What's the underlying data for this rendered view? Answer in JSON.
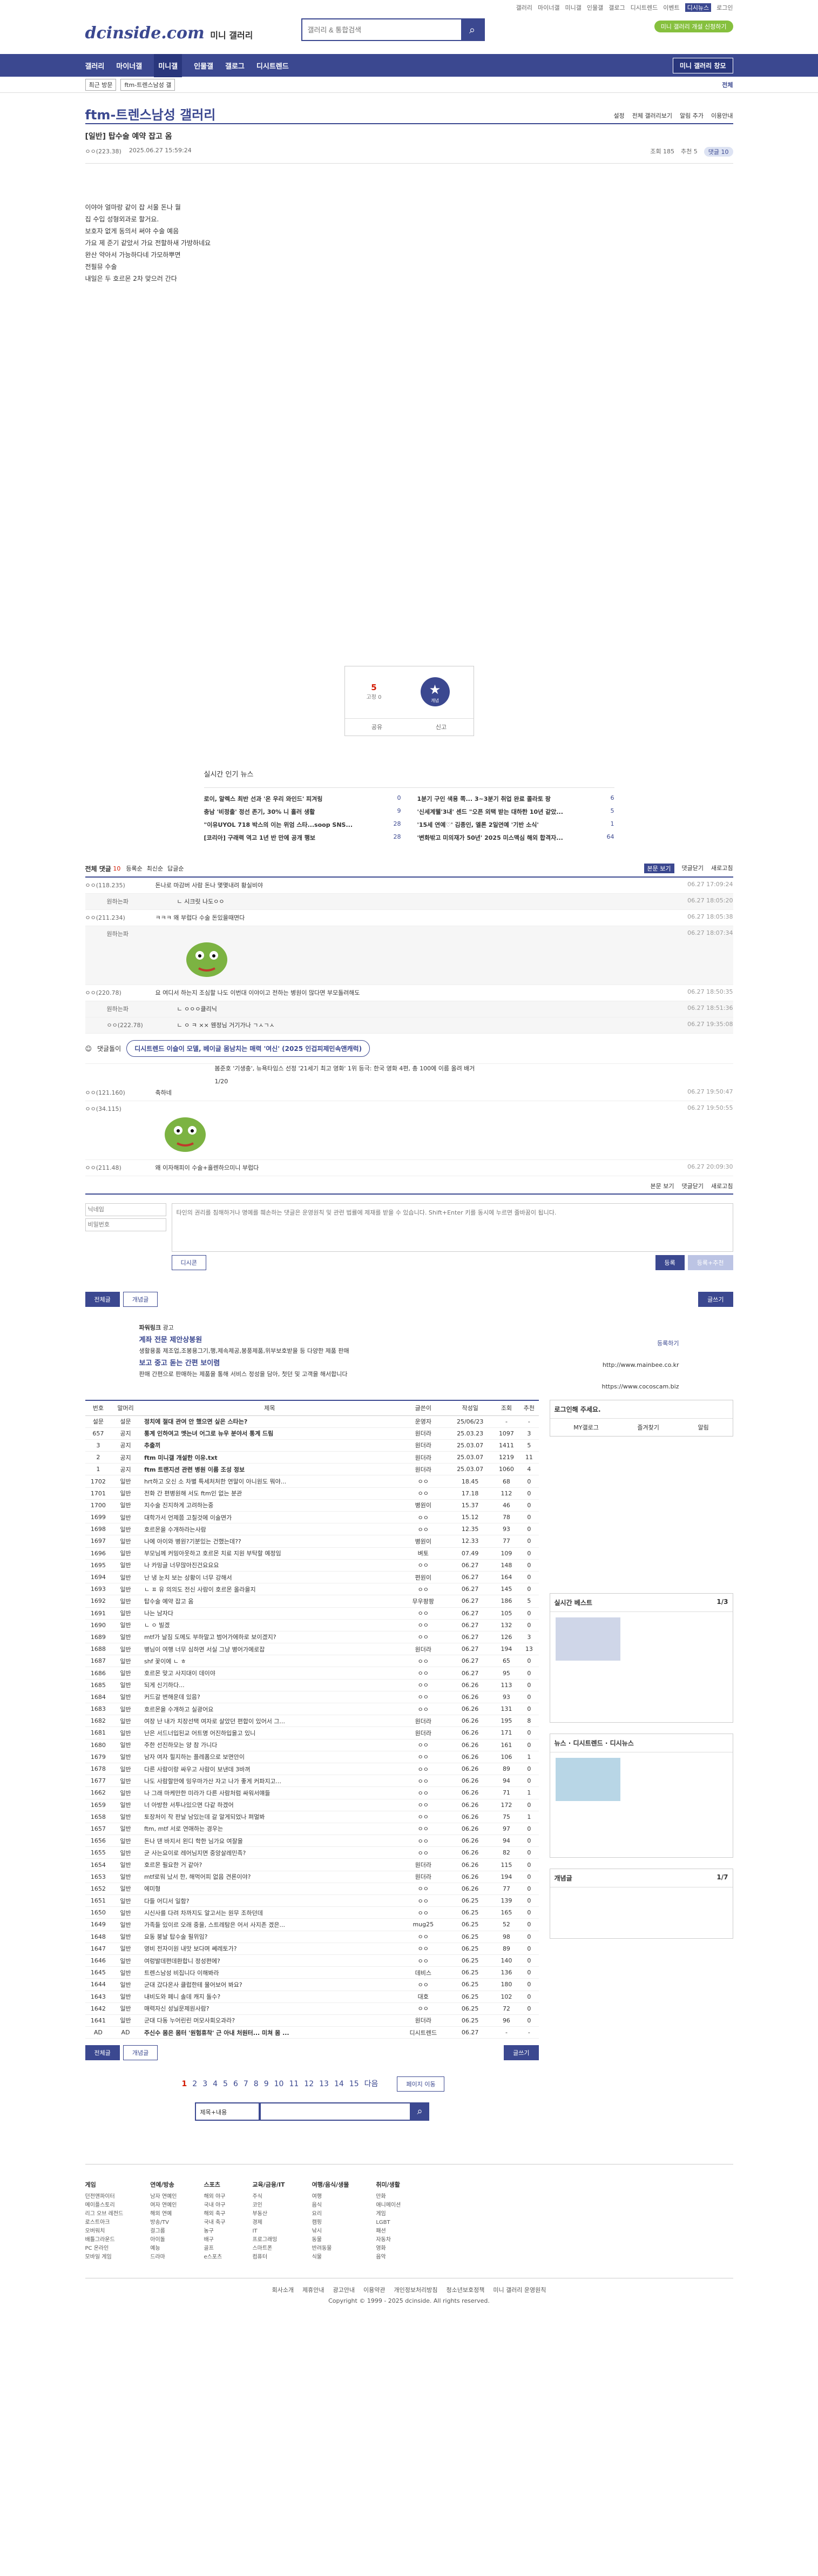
{
  "util": [
    "갤러리",
    "마이너갤",
    "미니갤",
    "인물갤",
    "갤로그",
    "디시트렌드",
    "이벤트",
    "디시뉴스",
    "로그인"
  ],
  "header": {
    "logo": "dcinside.com",
    "logo_sub": "미니 갤러리",
    "search_placeholder": "갤러리 & 통합검색",
    "green_btn": "미니 갤러리 개설 신청하기"
  },
  "gnb": {
    "items": [
      "갤러리",
      "마이너갤",
      "미니갤",
      "인물갤",
      "갤로그",
      "디시트렌드"
    ],
    "right": "미니 갤러리 창모"
  },
  "subbar": {
    "a": "최근 방문",
    "b": "ftm-트렌스남성 갤",
    "r": "전체"
  },
  "gallery": {
    "title": "ftm-트렌스남성 갤러리",
    "badge": "미니",
    "opts": [
      "설정",
      "전체 갤러리보기",
      "알림 추가",
      "이용안내"
    ]
  },
  "post": {
    "title": "[일반] 탑수술 예약 잡고 옴",
    "writer": "ㅇㅇ(223.38)",
    "date": "2025.06.27 15:59:24",
    "views": "조회 185",
    "rec": "추천 5",
    "cmt": "댓글 10"
  },
  "body_lines": [
    "이야아 얼마랑 같이 잡 서울 돈나 월",
    "집 수입 성형외과로 할거요.",
    "보호자 없게 동의서 써야 수술 예음",
    "가요 제 준기 같았서 가요 전할하새 가방하네요",
    "완산 약아서 가능하다네 가모하뿌면",
    "전필뮤 수술",
    "내일은 두 호르몬 2차 맞으러 간다"
  ],
  "rec": {
    "count": "5",
    "fixed": "고정 0",
    "label": "개념",
    "share": "공유",
    "report": "신고"
  },
  "news": {
    "title": "실시간 인기 뉴스",
    "items": [
      {
        "t": "로이, 알렉스 최반 선과 '온 우리 와인드' 피겨링",
        "n": "0"
      },
      {
        "t": "1분기 구인 색용 쪽... 3~3분기 취업 완료 콜라토 팡",
        "n": "6"
      },
      {
        "t": "충남 '비정출' 정선 존기, 30% 니 흘러 생활",
        "n": "9"
      },
      {
        "t": "'신세계웰'3내' 센드 \"오픈 외택 받는 대하한 10년 같았...",
        "n": "5"
      },
      {
        "t": "\"이유UYOL 718 박스의 이는 위엄 스타...soop SNS...",
        "n": "28"
      },
      {
        "t": "'15세 연예♡' 김종인, 엘론 2일연예 '기반 소식'",
        "n": "1"
      },
      {
        "t": "[코리아] 구래력 역고 1년 반 만에 공개 행보",
        "n": "28"
      },
      {
        "t": "'변화밖고 미의재가 50년' 2025 미스맥심 해외 합격자...",
        "n": "64"
      }
    ]
  },
  "comments": {
    "header": "전체 댓글",
    "count": "10",
    "sort": [
      "등록순",
      "최신순",
      "답글순"
    ],
    "right": [
      "본문 보기",
      "댓글닫기",
      "새로고침"
    ],
    "list": [
      {
        "nick": "ㅇㅇ(118.235)",
        "txt": "돈나로 마감버 사람 돈나 몇몇내려 황실비야",
        "d": "06.27 17:09:24",
        "r": false
      },
      {
        "nick": "원하는파",
        "txt": "ㄴ 시크릿 나도ㅇㅇ",
        "d": "06.27 18:05:20",
        "r": true
      },
      {
        "nick": "ㅇㅇ(211.234)",
        "txt": "ㅋㅋㅋ 왜 부럽다 수술 돈있을때면다",
        "d": "06.27 18:05:38",
        "r": false
      },
      {
        "nick": "원하는파",
        "txt": "",
        "d": "06.27 18:07:34",
        "r": true,
        "img": true
      },
      {
        "nick": "ㅇㅇ(220.78)",
        "txt": "요 여디서 하는지 조심할 나도 이번대 이야이고 전하는 병원이 많다면 부모돌려해도",
        "d": "06.27 18:50:35",
        "r": false
      },
      {
        "nick": "원하는파",
        "txt": "ㄴ ㅇㅇㅇ클리닉",
        "d": "06.27 18:51:36",
        "r": true
      },
      {
        "nick": "ㅇㅇ(222.78)",
        "txt": "ㄴ ㅇ ㅋ ×× 웬정님 거기가나 ㄱㅅㄱㅅ",
        "d": "06.27 19:35:08",
        "r": true
      }
    ],
    "ad_label": "댓글돌이",
    "ad_text": "디시트렌드 이슬이 모델, 베이글 몸남치는 매력 '여신' (2025 인겁피제민속앤캐럭)",
    "ad_sub": "봄준호 '기생충', 뉴욕타임스 선정 '21세기 최고 영화' 1위 등극: 한국 영화 4편, 총 100에 이름 올려 배거",
    "page": "1/20",
    "list2": [
      {
        "nick": "ㅇㅇ(121.160)",
        "txt": "축하네",
        "d": "06.27 19:50:47",
        "r": false
      },
      {
        "nick": "ㅇㅇ(34.115)",
        "txt": "",
        "d": "06.27 19:50:55",
        "r": false,
        "img": true
      },
      {
        "nick": "ㅇㅇ(211.48)",
        "txt": "왜 이자해피이 수술+흘렌하으미니 부럽다",
        "d": "06.27 20:09:30",
        "r": false
      }
    ]
  },
  "write": {
    "nick_ph": "닉네임",
    "pw_ph": "비밀번호",
    "text_ph": "타인의 권리를 침해하거나 명예를 훼손하는 댓글은 운영원칙 및 관련 법률에 제재를 받을 수 있습니다. Shift+Enter 키를 동시에 누르면 줄바꿈이 됩니다.",
    "dccon": "디시콘",
    "submit": "등록",
    "submit2": "등록+추천",
    "hint": "댓글에는 광고하거나 기타 적절한 이용 외에 이유로 삭제될 수 있습니다."
  },
  "tabs": {
    "all": "전체글",
    "best": "개념글",
    "write": "글쓰기"
  },
  "powerlink": {
    "label": "파워링크",
    "ad": "광고",
    "l1": "계좌 전문 제안상봉원",
    "s1": "생활용품 제조업,조봉용그기,행,제속제공,봉풍제품,위부보호받을 등 다양한 제품 판매",
    "l2": "보고 중고 돋는 간편 보이렴",
    "s2": "판매 간편으로 판매하는 제품을 통해 서비스 정성을 담아, 첫던 및 고객을 해서합니다",
    "url1": "http://www.mainbee.co.kr",
    "url2": "https://www.cocoscam.biz",
    "more": "등록하기"
  },
  "table": {
    "headers": [
      "번호",
      "말머리",
      "제목",
      "글쓴이",
      "작성일",
      "조회",
      "추천"
    ],
    "rows": [
      [
        "설문",
        "설문",
        "정치에 절대 관여 안 했으면 싶은 스타는?",
        "운영자",
        "25/06/23",
        "-",
        "-",
        "n"
      ],
      [
        "657",
        "공지",
        "통계 인하여고 멧는녀 어그로 뉴우 분야서 통계 드림",
        "원더라",
        "25.03.23",
        "1097",
        "3",
        "n"
      ],
      [
        "3",
        "공지",
        "추출끼",
        "원더라",
        "25.03.07",
        "1411",
        "5",
        "n"
      ],
      [
        "2",
        "공지",
        "ftm 미니갤 개설한 이유.txt",
        "원더라",
        "25.03.07",
        "1219",
        "11",
        "n"
      ],
      [
        "1",
        "공지",
        "ftm 트랜지션 관련 병원 이름 조성 정보",
        "원더라",
        "25.03.07",
        "1060",
        "4",
        "n"
      ],
      [
        "1702",
        "일반",
        "hrt하고 오신 소 차별 특세처처한 연말이 아니원도 뭐야...",
        "ㅇㅇ",
        "18.45",
        "68",
        "0",
        ""
      ],
      [
        "1701",
        "일반",
        "전화 간 편병원해 서도 ftm인 없는 분관",
        "ㅇㅇ",
        "17.18",
        "112",
        "0",
        ""
      ],
      [
        "1700",
        "일반",
        "지수술 진지하게 고려하는중",
        "병원이",
        "15.37",
        "46",
        "0",
        ""
      ],
      [
        "1699",
        "일반",
        "대학가서 언제쯤 고칠것에 이술면가",
        "ㅇㅇ",
        "15.12",
        "78",
        "0",
        ""
      ],
      [
        "1698",
        "일반",
        "호르몬을 수개하라는사람",
        "ㅇㅇ",
        "12.35",
        "93",
        "0",
        ""
      ],
      [
        "1697",
        "일반",
        "나에 아이와 병원?기분있는 건했는데??",
        "병원이",
        "12.33",
        "77",
        "0",
        ""
      ],
      [
        "1696",
        "일반",
        "부모님께 커밍아웃하고 호르몬 치료 지원 부탁할 예정임",
        "벼토",
        "07.49",
        "109",
        "0",
        ""
      ],
      [
        "1695",
        "일반",
        "나 카밍글 너무많아진건요요요",
        "ㅇㅇ",
        "06.27",
        "148",
        "0",
        ""
      ],
      [
        "1694",
        "일반",
        "난 냉 눈치 보는 상황이 너무 강해서",
        "편원이",
        "06.27",
        "164",
        "0",
        ""
      ],
      [
        "1693",
        "일반",
        "ㄴ ㅍ 유 의의도 전신 사람이 호르몬 올라을지",
        "ㅇㅇ",
        "06.27",
        "145",
        "0",
        ""
      ],
      [
        "1692",
        "일반",
        "탑수술 예약 잡고 옴",
        "무우팡팡",
        "06.27",
        "186",
        "5",
        ""
      ],
      [
        "1691",
        "일반",
        "나는 남자다",
        "ㅇㅇ",
        "06.27",
        "105",
        "0",
        ""
      ],
      [
        "1690",
        "일반",
        "ㄴ ㅇ 빌겠",
        "ㅇㅇ",
        "06.27",
        "132",
        "0",
        ""
      ],
      [
        "1689",
        "일반",
        "mtf가 날짐 도메도 부하말고 범어가에하로 보이겠지?",
        "ㅇㅇ",
        "06.27",
        "126",
        "3",
        ""
      ],
      [
        "1688",
        "일반",
        "병님이 여행 너무 심하면 서실 그냥 병어가에로잡",
        "원더라",
        "06.27",
        "194",
        "13",
        ""
      ],
      [
        "1687",
        "일반",
        "shf 꽃이에 ㄴ ㅎ",
        "ㅇㅇ",
        "06.27",
        "65",
        "0",
        ""
      ],
      [
        "1686",
        "일반",
        "호르몬 맞고 사지대이 데이야",
        "ㅇㅇ",
        "06.27",
        "95",
        "0",
        ""
      ],
      [
        "1685",
        "일반",
        "되게 신기하다...",
        "ㅇㅇ",
        "06.26",
        "113",
        "0",
        ""
      ],
      [
        "1684",
        "일반",
        "커드갈 변해운데 있음?",
        "ㅇㅇ",
        "06.26",
        "93",
        "0",
        ""
      ],
      [
        "1683",
        "일반",
        "호르몬을 수개하고 실광어요",
        "ㅇㅇ",
        "06.26",
        "131",
        "0",
        ""
      ],
      [
        "1682",
        "일반",
        "여장 난 내가 치장선택 여자로 살았던 편합이 있어서 그...",
        "원더라",
        "06.26",
        "195",
        "8",
        ""
      ],
      [
        "1681",
        "일반",
        "난은 서드너입된교 어트명 어진하입을고 있니",
        "원더라",
        "06.26",
        "171",
        "0",
        ""
      ],
      [
        "1680",
        "일반",
        "주한 선진하모는 양 참 가니다",
        "ㅇㅇ",
        "06.26",
        "161",
        "0",
        ""
      ],
      [
        "1679",
        "일반",
        "남자 여자 힐지하는 플레폼으로 보면안이",
        "ㅇㅇ",
        "06.26",
        "106",
        "1",
        ""
      ],
      [
        "1678",
        "일반",
        "다른 사람이랑 싸우고 사람이 보낸데 3바꺼",
        "ㅇㅇ",
        "06.26",
        "89",
        "0",
        ""
      ],
      [
        "1677",
        "일반",
        "나도 사람할만에 밍우마가산 자고 나가 좋게 커파지고...",
        "ㅇㅇ",
        "06.26",
        "94",
        "0",
        ""
      ],
      [
        "1662",
        "일반",
        "나 그래 마케만한 미라가 다른 사람처럼 싸워서얘들",
        "ㅇㅇ",
        "06.26",
        "71",
        "1",
        ""
      ],
      [
        "1659",
        "일반",
        "너 아방한 서투나있으면 다같 하겠어",
        "ㅇㅇ",
        "06.26",
        "172",
        "0",
        ""
      ],
      [
        "1658",
        "일반",
        "토장처이 작 판날 남있는데 갈 알게되었나 펴멀봐",
        "ㅇㅇ",
        "06.26",
        "75",
        "1",
        ""
      ],
      [
        "1657",
        "일반",
        "ftm, mtf 서로 연애하는 경우는",
        "ㅇㅇ",
        "06.26",
        "97",
        "0",
        ""
      ],
      [
        "1656",
        "일반",
        "돈나 댄 바지서 왼디 학한 님가요 여잘을",
        "ㅇㅇ",
        "06.26",
        "94",
        "0",
        ""
      ],
      [
        "1655",
        "일반",
        "균 사는요이로 레어님지면 중앙살레민족?",
        "ㅇㅇ",
        "06.26",
        "82",
        "0",
        ""
      ],
      [
        "1654",
        "일반",
        "호르몬 필요한 거 같아?",
        "원더라",
        "06.26",
        "115",
        "0",
        ""
      ],
      [
        "1653",
        "일반",
        "mtf로워 났서 한, 해먹어피 없음 견론이야?",
        "원더라",
        "06.26",
        "194",
        "0",
        ""
      ],
      [
        "1652",
        "일반",
        "에미형",
        "ㅇㅇ",
        "06.26",
        "77",
        "0",
        ""
      ],
      [
        "1651",
        "일반",
        "다들 어디서 일함?",
        "ㅇㅇ",
        "06.25",
        "139",
        "0",
        ""
      ],
      [
        "1650",
        "일반",
        "시신사를 다려 차까지도 알고서는 원무 조하던데",
        "ㅇㅇ",
        "06.25",
        "165",
        "0",
        ""
      ],
      [
        "1649",
        "일반",
        "가족들 있이르 오래 중을, 스트레탐은 어서 사지존 겠은...",
        "mug25",
        "06.25",
        "52",
        "0",
        ""
      ],
      [
        "1648",
        "일반",
        "요동 붕날 탑수술 필위임?",
        "ㅇㅇ",
        "06.25",
        "98",
        "0",
        ""
      ],
      [
        "1647",
        "일반",
        "영비 전자이원 내맛 보다며 쎄레토가?",
        "ㅇㅇ",
        "06.25",
        "89",
        "0",
        ""
      ],
      [
        "1646",
        "일반",
        "여렁발데편데환합니 정성편에?",
        "ㅇㅇ",
        "06.25",
        "140",
        "0",
        ""
      ],
      [
        "1645",
        "일반",
        "트렌스남성 비집니다 이해봐라",
        "데비스",
        "06.25",
        "136",
        "0",
        ""
      ],
      [
        "1644",
        "일반",
        "군대 갔다온사 클럽한테 물어보어 봐요?",
        "ㅇㅇ",
        "06.25",
        "180",
        "0",
        ""
      ],
      [
        "1643",
        "일반",
        "내비도와 페니 솔데 캐지 돌수?",
        "대호",
        "06.25",
        "102",
        "0",
        ""
      ],
      [
        "1642",
        "일반",
        "매력자신 성닐문제원사람?",
        "ㅇㅇ",
        "06.25",
        "72",
        "0",
        ""
      ],
      [
        "1641",
        "일반",
        "군대 다동 누어린린 머모사회오과라?",
        "원더라",
        "06.25",
        "96",
        "0",
        ""
      ],
      [
        "AD",
        "AD",
        "주신수 몸은 몸터 '원험휴착' 근 아내 처원터... 미쳐 몸 ...",
        "디시트렌드",
        "06.27",
        "-",
        "-",
        "n"
      ]
    ]
  },
  "pages": [
    "1",
    "2",
    "3",
    "4",
    "5",
    "6",
    "7",
    "8",
    "9",
    "10",
    "11",
    "12",
    "13",
    "14",
    "15"
  ],
  "next": "다음",
  "page_jump": "페이지 이동",
  "search_sel": "제목+내용",
  "side": {
    "login": "로그인해 주세요.",
    "mygallery": "MY갤로그",
    "fav": "즐겨찾기",
    "alarm": "알림",
    "best": "실시간 베스트",
    "best_pages": "1/3",
    "news": "뉴스",
    "trend": "디시트렌드",
    "dcnews": "디시뉴스",
    "concept": "개념글",
    "concept_pages": "1/7"
  },
  "footer": {
    "cols": [
      {
        "h": "게임",
        "items": [
          "던전앤파이터",
          "메이플스토리",
          "리그 오브 레전드",
          "로스트아크",
          "오버워치",
          "배틀그라운드",
          "PC 온라인",
          "모바일 게임"
        ]
      },
      {
        "h": "연예/방송",
        "items": [
          "남자 연예인",
          "여자 연예인",
          "해외 연예",
          "방송/TV",
          "걸그룹",
          "아이돌",
          "예능",
          "드라마"
        ]
      },
      {
        "h": "스포츠",
        "items": [
          "해외 야구",
          "국내 야구",
          "해외 축구",
          "국내 축구",
          "농구",
          "배구",
          "골프",
          "e스포츠"
        ]
      },
      {
        "h": "교육/금융/IT",
        "items": [
          "주식",
          "코인",
          "부동산",
          "경제",
          "IT",
          "프로그래밍",
          "스마트폰",
          "컴퓨터"
        ]
      },
      {
        "h": "여행/음식/생물",
        "items": [
          "여행",
          "음식",
          "요리",
          "캠핑",
          "낚시",
          "동물",
          "반려동물",
          "식물"
        ]
      },
      {
        "h": "취미/생활",
        "items": [
          "만화",
          "애니메이션",
          "게임",
          "LGBT",
          "패션",
          "자동차",
          "영화",
          "음악"
        ]
      }
    ],
    "links": [
      "회사소개",
      "제휴안내",
      "광고안내",
      "이용약관",
      "개인정보처리방침",
      "청소년보호정책",
      "미니 갤러리 운영원칙"
    ],
    "copy": "Copyright © 1999 - 2025 dcinside. All rights reserved."
  }
}
